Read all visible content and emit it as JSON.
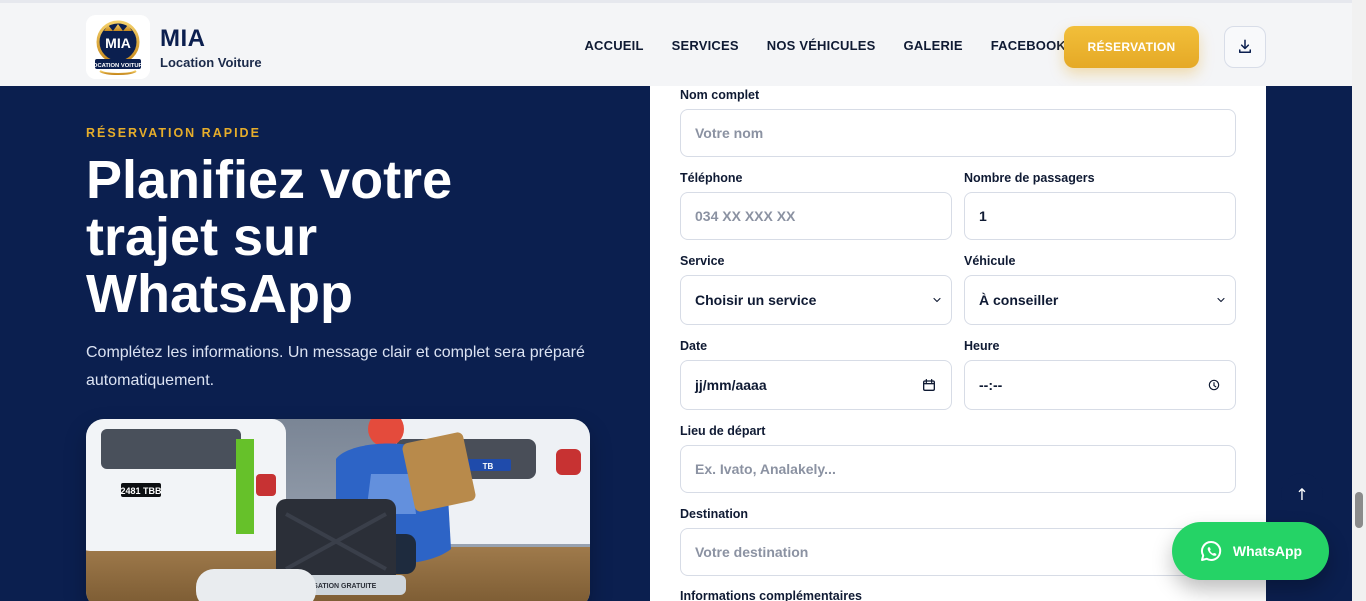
{
  "header": {
    "brand_title": "MIA",
    "brand_subtitle": "Location Voiture",
    "logo_text_main": "MIA",
    "logo_text_bottom": "LOCATION VOITURE",
    "nav": [
      {
        "label": "ACCUEIL"
      },
      {
        "label": "SERVICES"
      },
      {
        "label": "NOS VÉHICULES"
      },
      {
        "label": "GALERIE"
      },
      {
        "label": "FACEBOOK"
      }
    ],
    "cta_label": "RÉSERVATION"
  },
  "hero": {
    "kicker": "RÉSERVATION RAPIDE",
    "title": "Planifiez votre trajet sur WhatsApp",
    "lead": "Complétez les informations. Un message clair et complet sera préparé automatiquement."
  },
  "form": {
    "fields": {
      "full_name": {
        "label": "Nom complet",
        "placeholder": "Votre nom"
      },
      "phone": {
        "label": "Téléphone",
        "placeholder": "034 XX XXX XX"
      },
      "passengers": {
        "label": "Nombre de passagers",
        "value": "1"
      },
      "service": {
        "label": "Service",
        "selected": "Choisir un service"
      },
      "vehicle": {
        "label": "Véhicule",
        "selected": "À conseiller"
      },
      "date": {
        "label": "Date",
        "placeholder": "jj/mm/aaaa"
      },
      "time": {
        "label": "Heure",
        "placeholder": "--:--"
      },
      "departure": {
        "label": "Lieu de départ",
        "placeholder": "Ex. Ivato, Analakely..."
      },
      "destination": {
        "label": "Destination",
        "placeholder": "Votre destination"
      },
      "extra_label": "Informations complémentaires"
    }
  },
  "photo": {
    "plate_left": "2481 TBB",
    "plate_right": "TB",
    "luggage_label": "UTILISATION GRATUITE"
  },
  "floating": {
    "whatsapp_label": "WhatsApp",
    "scroll_top_glyph": "↑"
  },
  "colors": {
    "navy": "#0b1f4f",
    "gold": "#e6ad2b",
    "whatsapp_green": "#25d366"
  }
}
